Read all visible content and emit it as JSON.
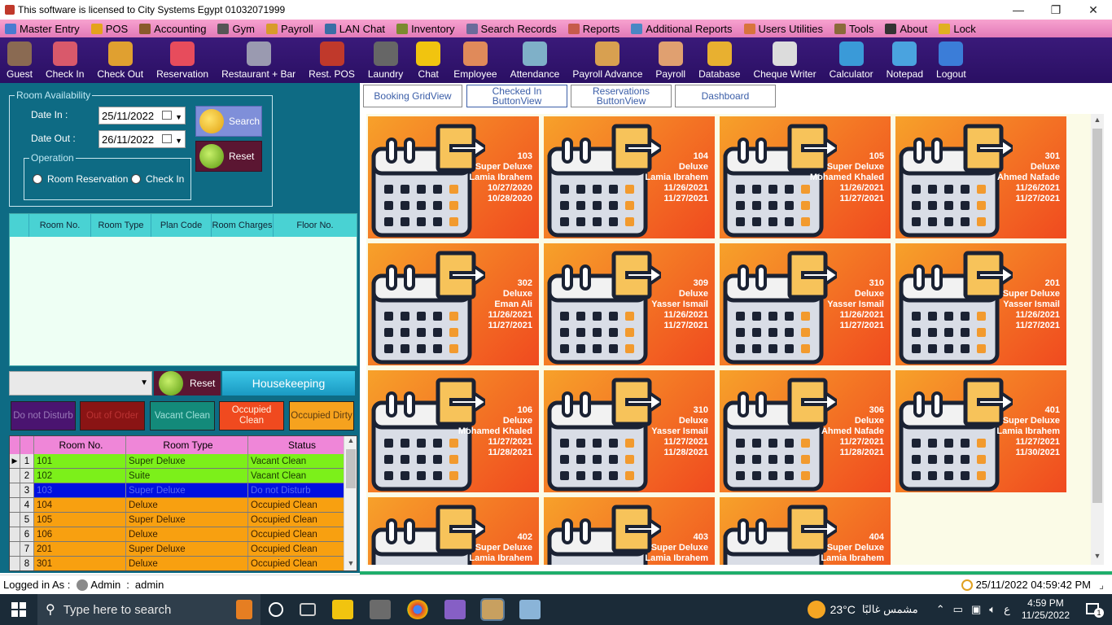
{
  "window": {
    "title": "This software is licensed to City Systems Egypt 01032071999",
    "minimize": "—",
    "restore": "❐",
    "close": "✕"
  },
  "menu": [
    {
      "label": "Master Entry",
      "icon": "master-entry-icon",
      "color": "#4a7bd1"
    },
    {
      "label": "POS",
      "icon": "pos-icon",
      "color": "#e4a31c"
    },
    {
      "label": "Accounting",
      "icon": "accounting-icon",
      "color": "#8a5a2b"
    },
    {
      "label": "Gym",
      "icon": "gym-icon",
      "color": "#555555"
    },
    {
      "label": "Payroll",
      "icon": "payroll-icon",
      "color": "#d89b2a"
    },
    {
      "label": "LAN Chat",
      "icon": "lan-chat-icon",
      "color": "#3a6ea5"
    },
    {
      "label": "Inventory",
      "icon": "inventory-icon",
      "color": "#7b8a2e"
    },
    {
      "label": "Search Records",
      "icon": "search-records-icon",
      "color": "#6b6b9b"
    },
    {
      "label": "Reports",
      "icon": "reports-icon",
      "color": "#c65b4b"
    },
    {
      "label": "Additional Reports",
      "icon": "additional-reports-icon",
      "color": "#4a87c4"
    },
    {
      "label": "Users Utilities",
      "icon": "users-utilities-icon",
      "color": "#d8743d"
    },
    {
      "label": "Tools",
      "icon": "tools-icon",
      "color": "#8a6a3a"
    },
    {
      "label": "About",
      "icon": "about-icon",
      "color": "#333333"
    },
    {
      "label": "Lock",
      "icon": "lock-icon",
      "color": "#e0b020"
    }
  ],
  "toolbar": [
    {
      "label": "Guest",
      "icon": "guest-icon",
      "color": "#8a6a52"
    },
    {
      "label": "Check In",
      "icon": "check-in-icon",
      "color": "#d9596b"
    },
    {
      "label": "Check Out",
      "icon": "check-out-icon",
      "color": "#e0a030"
    },
    {
      "label": "Reservation",
      "icon": "reservation-icon",
      "color": "#e74c5c"
    },
    {
      "label": "Restaurant + Bar",
      "icon": "restaurant-icon",
      "color": "#9a9ab0"
    },
    {
      "label": "Rest. POS",
      "icon": "rest-pos-icon",
      "color": "#c0392b"
    },
    {
      "label": "Laundry",
      "icon": "laundry-icon",
      "color": "#666666"
    },
    {
      "label": "Chat",
      "icon": "chat-icon",
      "color": "#f1c40f"
    },
    {
      "label": "Employee",
      "icon": "employee-icon",
      "color": "#e08a5a"
    },
    {
      "label": "Attendance",
      "icon": "attendance-icon",
      "color": "#7fb0c8"
    },
    {
      "label": "Payroll Advance",
      "icon": "payroll-advance-icon",
      "color": "#d8a050"
    },
    {
      "label": "Payroll",
      "icon": "payroll-tb-icon",
      "color": "#e0a070"
    },
    {
      "label": "Database",
      "icon": "database-icon",
      "color": "#e8b030"
    },
    {
      "label": "Cheque Writer",
      "icon": "cheque-writer-icon",
      "color": "#dcdcdc"
    },
    {
      "label": "Calculator",
      "icon": "calculator-icon",
      "color": "#3a9ad8"
    },
    {
      "label": "Notepad",
      "icon": "notepad-icon",
      "color": "#4aa3df"
    },
    {
      "label": "Logout",
      "icon": "logout-icon",
      "color": "#3b7dd8"
    }
  ],
  "availability": {
    "legend": "Room Availability",
    "date_in_label": "Date In :",
    "date_in": "25/11/2022",
    "date_out_label": "Date Out :",
    "date_out": "26/11/2022",
    "search_label": "Search",
    "reset_label": "Reset",
    "operation_legend": "Operation",
    "opt_reservation": "Room Reservation",
    "opt_checkin": "Check In"
  },
  "rooms_grid": {
    "columns": [
      "Room No.",
      "Room Type",
      "Plan Code",
      "Room Charges",
      "Floor No."
    ]
  },
  "housekeeping": {
    "reset_label": "Reset",
    "title": "Housekeeping",
    "statuses": [
      {
        "label": "Do not Disturb",
        "bg": "#4a1470",
        "fg": "#9a7ab8"
      },
      {
        "label": "Out of Order",
        "bg": "#8a1414",
        "fg": "#b33"
      },
      {
        "label": "Vacant Clean",
        "bg": "#138a7a",
        "fg": "#9ee0d8"
      },
      {
        "label": "Occupied Clean",
        "bg": "#f04a1f",
        "fg": "#fff0e0"
      },
      {
        "label": "Occupied Dirty",
        "bg": "#f6a21e",
        "fg": "#5a3a10"
      }
    ],
    "columns": [
      "Room No.",
      "Room Type",
      "Status"
    ],
    "rows": [
      {
        "n": "1",
        "room": "101",
        "type": "Super Deluxe",
        "status": "Vacant Clean",
        "bg": "#7cf01a",
        "fg": "#1a3a00"
      },
      {
        "n": "2",
        "room": "102",
        "type": "Suite",
        "status": "Vacant Clean",
        "bg": "#7cf01a",
        "fg": "#1a3a00"
      },
      {
        "n": "3",
        "room": "103",
        "type": "Super Deluxe",
        "status": "Do not Disturb",
        "bg": "#0010e0",
        "fg": "#5a6af0"
      },
      {
        "n": "4",
        "room": "104",
        "type": "Deluxe",
        "status": "Occupied Clean",
        "bg": "#f8a010",
        "fg": "#3a2000"
      },
      {
        "n": "5",
        "room": "105",
        "type": "Super Deluxe",
        "status": "Occupied Clean",
        "bg": "#f8a010",
        "fg": "#3a2000"
      },
      {
        "n": "6",
        "room": "106",
        "type": "Deluxe",
        "status": "Occupied Clean",
        "bg": "#f8a010",
        "fg": "#3a2000"
      },
      {
        "n": "7",
        "room": "201",
        "type": "Super Deluxe",
        "status": "Occupied Clean",
        "bg": "#f8a010",
        "fg": "#3a2000"
      },
      {
        "n": "8",
        "room": "301",
        "type": "Deluxe",
        "status": "Occupied Clean",
        "bg": "#f8a010",
        "fg": "#3a2000"
      }
    ]
  },
  "tabs": [
    "Booking GridView",
    "Checked In ButtonView",
    "Reservations ButtonView",
    "Dashboard"
  ],
  "cards": [
    {
      "room": "103",
      "type": "Super Deluxe",
      "guest": "Lamia Ibrahem",
      "in": "10/27/2020",
      "out": "10/28/2020"
    },
    {
      "room": "104",
      "type": "Deluxe",
      "guest": "Lamia Ibrahem",
      "in": "11/26/2021",
      "out": "11/27/2021"
    },
    {
      "room": "105",
      "type": "Super Deluxe",
      "guest": "Mohamed Khaled",
      "in": "11/26/2021",
      "out": "11/27/2021"
    },
    {
      "room": "301",
      "type": "Deluxe",
      "guest": "Ahmed Nafade",
      "in": "11/26/2021",
      "out": "11/27/2021"
    },
    {
      "room": "302",
      "type": "Deluxe",
      "guest": "Eman Ali",
      "in": "11/26/2021",
      "out": "11/27/2021"
    },
    {
      "room": "309",
      "type": "Deluxe",
      "guest": "Yasser Ismail",
      "in": "11/26/2021",
      "out": "11/27/2021"
    },
    {
      "room": "310",
      "type": "Deluxe",
      "guest": "Yasser Ismail",
      "in": "11/26/2021",
      "out": "11/27/2021"
    },
    {
      "room": "201",
      "type": "Super Deluxe",
      "guest": "Yasser Ismail",
      "in": "11/26/2021",
      "out": "11/27/2021"
    },
    {
      "room": "106",
      "type": "Deluxe",
      "guest": "Mohamed Khaled",
      "in": "11/27/2021",
      "out": "11/28/2021"
    },
    {
      "room": "310",
      "type": "Deluxe",
      "guest": "Yasser Ismail",
      "in": "11/27/2021",
      "out": "11/28/2021"
    },
    {
      "room": "306",
      "type": "Deluxe",
      "guest": "Ahmed Nafade",
      "in": "11/27/2021",
      "out": "11/28/2021"
    },
    {
      "room": "401",
      "type": "Super Deluxe",
      "guest": "Lamia Ibrahem",
      "in": "11/27/2021",
      "out": "11/30/2021"
    },
    {
      "room": "402",
      "type": "Super Deluxe",
      "guest": "Lamia Ibrahem",
      "in": "",
      "out": ""
    },
    {
      "room": "403",
      "type": "Super Deluxe",
      "guest": "Lamia Ibrahem",
      "in": "",
      "out": ""
    },
    {
      "room": "404",
      "type": "Super Deluxe",
      "guest": "Lamia Ibrahem",
      "in": "",
      "out": ""
    }
  ],
  "status": {
    "logged_label": "Logged in As :",
    "user_role": "Admin",
    "separator": ":",
    "username": "admin",
    "datetime": "25/11/2022 04:59:42 PM"
  },
  "taskbar": {
    "search_placeholder": "Type here to search",
    "weather": "23°C",
    "weather_text": "مشمس غالبًا",
    "lang": "ع",
    "time": "4:59 PM",
    "date": "11/25/2022",
    "notif_count": "1"
  },
  "colors": {
    "accent": "#2a0f63",
    "panel": "#0e6b84",
    "card_from": "#f7a12a",
    "card_to": "#f04a1f"
  }
}
